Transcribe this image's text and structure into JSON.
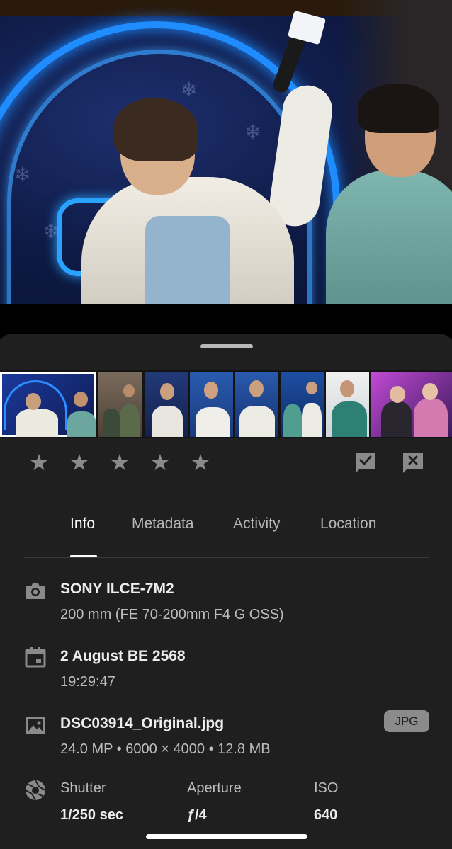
{
  "rating": {
    "stars": 5,
    "value": 0
  },
  "tabs": [
    {
      "label": "Info",
      "active": true
    },
    {
      "label": "Metadata",
      "active": false
    },
    {
      "label": "Activity",
      "active": false
    },
    {
      "label": "Location",
      "active": false
    }
  ],
  "camera": {
    "model": "SONY ILCE-7M2",
    "lens": "200 mm (FE 70-200mm F4 G OSS)"
  },
  "date": {
    "day": "2 August BE 2568",
    "time": "19:29:47"
  },
  "file": {
    "name": "DSC03914_Original.jpg",
    "details": "24.0 MP • 6000 × 4000 • 12.8 MB",
    "format_badge": "JPG"
  },
  "exposure": {
    "shutter_label": "Shutter",
    "shutter_value": "1/250 sec",
    "aperture_label": "Aperture",
    "aperture_value": "ƒ/4",
    "iso_label": "ISO",
    "iso_value": "640"
  },
  "colors": {
    "background": "#1f1f1f",
    "icon": "#8a8a8a",
    "badge": "#8b8b8b"
  },
  "icons": [
    "camera-icon",
    "calendar-icon",
    "image-icon",
    "aperture-icon",
    "star-icon",
    "pick-flag-icon",
    "reject-flag-icon"
  ]
}
